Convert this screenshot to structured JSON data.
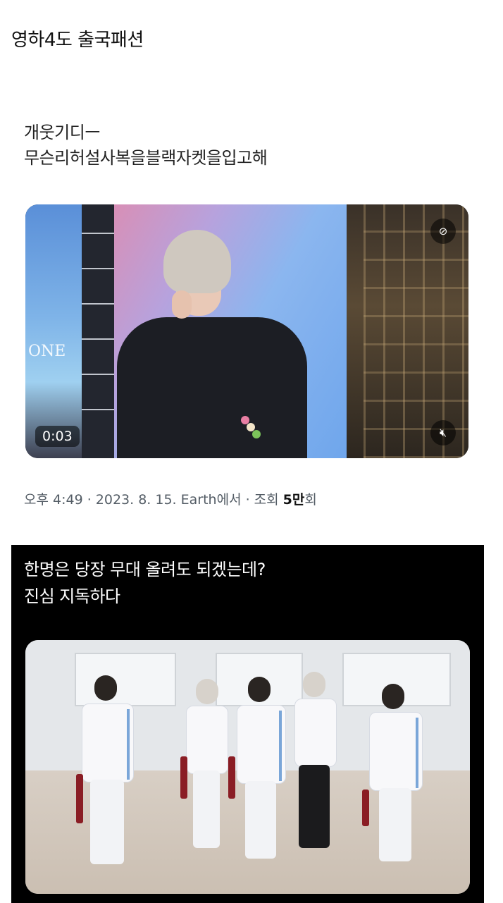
{
  "post": {
    "title": "영하4도 출국패션",
    "tweet_lines": [
      "개웃기디ㅡ",
      "무슨리허설사복을블랙자켓을입고해"
    ]
  },
  "video": {
    "screen_text": "ONE",
    "time": "0:03",
    "captions_icon": "captions-off-icon",
    "mute_icon": "speaker-muted-icon"
  },
  "meta": {
    "prefix": "오후 4:49 · 2023. 8. 15. Earth에서 · 조회 ",
    "views": "5만",
    "suffix": "회"
  },
  "caption": {
    "lines": [
      "한명은 당장 무대 올려도 되겠는데?",
      "진심 지독하다"
    ]
  }
}
